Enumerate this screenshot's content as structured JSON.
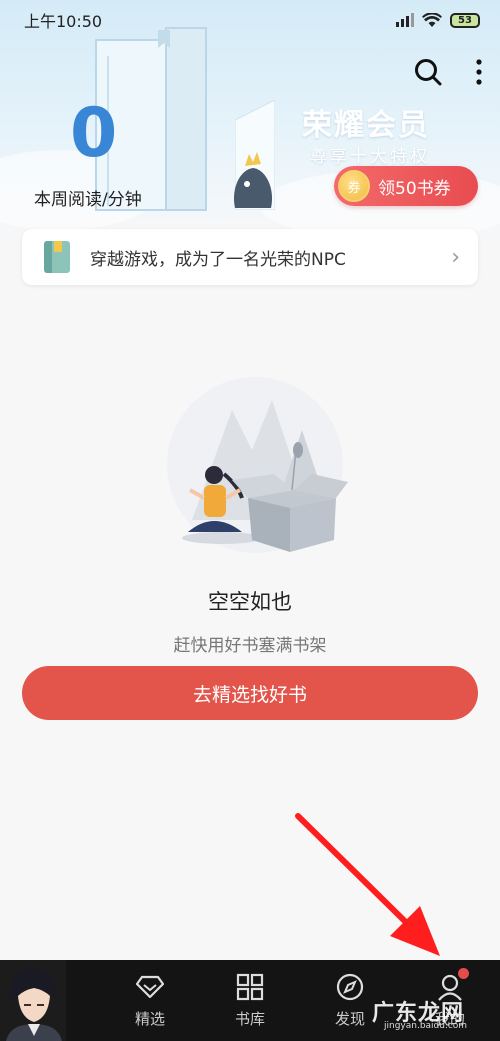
{
  "status_bar": {
    "time": "上午10:50",
    "battery": "53"
  },
  "header": {
    "weekly_reading_value": "0",
    "weekly_reading_label": "本周阅读/分钟",
    "vip_title": "荣耀会员",
    "vip_subtitle": "尊享十大特权",
    "coupon_icon_text": "券",
    "coupon_label": "领50书券"
  },
  "recommend": {
    "text": "穿越游戏，成为了一名光荣的NPC"
  },
  "empty_state": {
    "title": "空空如也",
    "subtitle": "赶快用好书塞满书架",
    "cta_label": "去精选找好书"
  },
  "bottom_nav": {
    "items": [
      {
        "label": "精选",
        "icon": "diamond-icon"
      },
      {
        "label": "书库",
        "icon": "grid-icon"
      },
      {
        "label": "发现",
        "icon": "compass-icon"
      },
      {
        "label": "我的",
        "icon": "person-icon"
      }
    ]
  },
  "watermark": {
    "text": "广东龙网",
    "sub": "jingyan.baidu.com"
  },
  "colors": {
    "accent_red": "#e3544b",
    "reading_blue": "#3a86d6",
    "nav_bg": "#141414"
  }
}
